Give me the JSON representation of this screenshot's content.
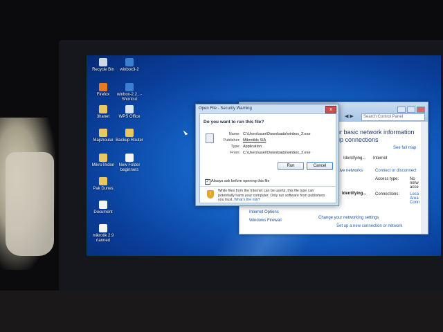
{
  "desktop": {
    "icons": [
      {
        "label": "Recycle Bin",
        "icon": "recycle-bin-icon"
      },
      {
        "label": "Firefox",
        "icon": "firefox-icon"
      },
      {
        "label": "3hanet",
        "icon": "folder-icon"
      },
      {
        "label": "Majshouse",
        "icon": "folder-icon"
      },
      {
        "label": "MikroTikdon",
        "icon": "folder-icon"
      },
      {
        "label": "Pak Dunes",
        "icon": "folder-icon"
      },
      {
        "label": "Document",
        "icon": "document-icon"
      },
      {
        "label": "mikrotik 2.9 rlanned",
        "icon": "document-icon"
      },
      {
        "label": "winbox3-2",
        "icon": "winbox-icon"
      },
      {
        "label": "winbox-2.2...- Shortcut",
        "icon": "winbox-icon"
      },
      {
        "label": "WPS Office",
        "icon": "wps-office-icon"
      },
      {
        "label": "Backup Router",
        "icon": "folder-icon"
      },
      {
        "label": "New Folder beginners",
        "icon": "document-icon"
      }
    ]
  },
  "control_panel": {
    "search_placeholder": "Search Control Panel",
    "nav_arrows": "◀ ▶",
    "heading": "ur basic network information",
    "heading2": "up connections",
    "see_full_map": "See full map",
    "identifying": "Identifying...",
    "internet": "Internet",
    "active_networks": "ctive networks",
    "connect_disconnect": "Connect or disconnect",
    "access_type_label": "Access type:",
    "access_type_value": "No netw acce",
    "connections_label": "Connections:",
    "connections_value": "Loca Area Conn",
    "identifying2": "Identifying...",
    "change_settings": "Change your networking settings",
    "setup_connection": "Set up a new connection or network",
    "internet_options": "Internet Options",
    "windows_firewall": "Windows Firewall"
  },
  "dialog": {
    "title": "Open File - Security Warning",
    "close": "x",
    "question": "Do you want to run this file?",
    "name_label": "Name:",
    "name_value": "C:\\Users\\user\\Downloads\\winbox_2.exe",
    "publisher_label": "Publisher:",
    "publisher_value": "Mikrotikls SIA",
    "type_label": "Type:",
    "type_value": "Application",
    "from_label": "From:",
    "from_value": "C:\\Users\\user\\Downloads\\winbox_2.exe",
    "run_label": "Run",
    "cancel_label": "Cancel",
    "checkbox_checked": true,
    "checkbox_label": "Always ask before opening this file",
    "warning_text": "While files from the Internet can be useful, this file type can potentially harm your computer. Only run software from publishers you trust.",
    "warning_link": "What's the risk?"
  }
}
